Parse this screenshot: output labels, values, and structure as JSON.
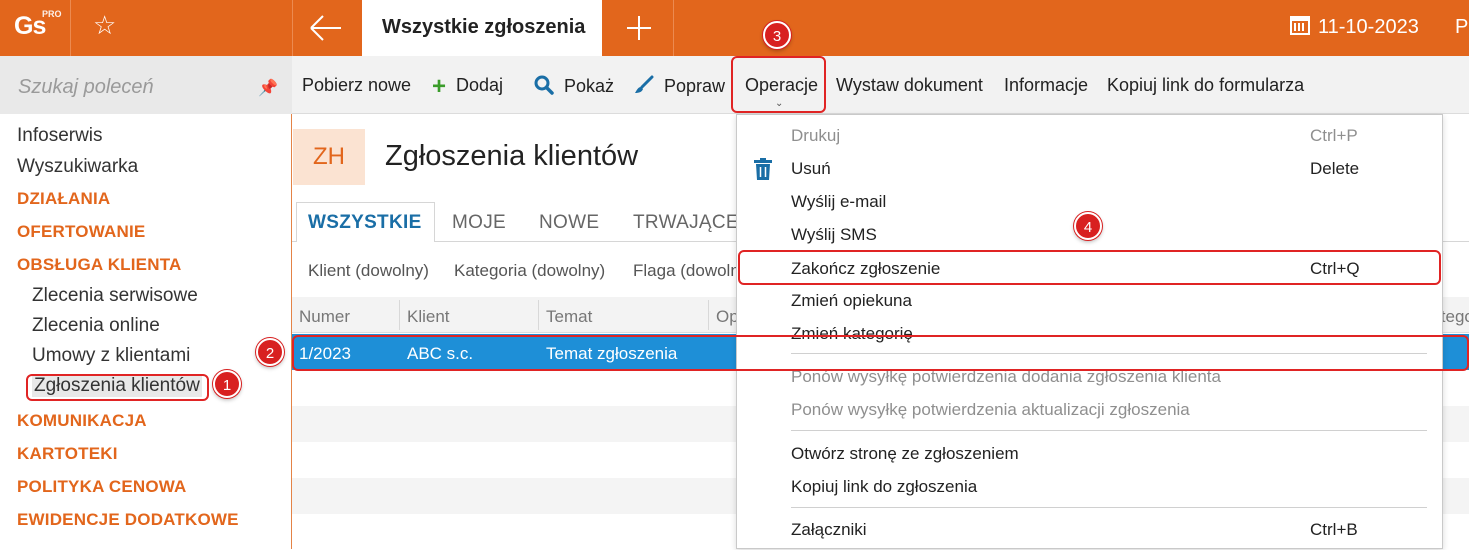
{
  "app": {
    "logo_text": "Gs",
    "logo_badge": "PRO",
    "active_tab": "Wszystkie zgłoszenia",
    "date": "11-10-2023",
    "user_initials_partial": "P("
  },
  "sidebar": {
    "search_placeholder": "Szukaj poleceń",
    "items": [
      {
        "label": "Infoserwis",
        "type": "item"
      },
      {
        "label": "Wyszukiwarka",
        "type": "item"
      },
      {
        "label": "DZIAŁANIA",
        "type": "section"
      },
      {
        "label": "OFERTOWANIE",
        "type": "section"
      },
      {
        "label": "OBSŁUGA KLIENTA",
        "type": "section"
      },
      {
        "label": "Zlecenia serwisowe",
        "type": "sub"
      },
      {
        "label": "Zlecenia online",
        "type": "sub"
      },
      {
        "label": "Umowy z klientami",
        "type": "sub"
      },
      {
        "label": "Zgłoszenia klientów",
        "type": "sub",
        "selected": true
      },
      {
        "label": "KOMUNIKACJA",
        "type": "section"
      },
      {
        "label": "KARTOTEKI",
        "type": "section"
      },
      {
        "label": "POLITYKA CENOWA",
        "type": "section"
      },
      {
        "label": "EWIDENCJE DODATKOWE",
        "type": "section"
      }
    ]
  },
  "toolbar": {
    "fetch_new": "Pobierz nowe",
    "add": "Dodaj",
    "show": "Pokaż",
    "edit": "Popraw",
    "operations": "Operacje",
    "issue_document": "Wystaw dokument",
    "info": "Informacje",
    "copy_form_link": "Kopiuj link do formularza"
  },
  "page": {
    "badge": "ZH",
    "title": "Zgłoszenia klientów",
    "tabs": [
      "WSZYSTKIE",
      "MOJE",
      "NOWE",
      "TRWAJĄCE"
    ],
    "filters": [
      "Klient (dowolny)",
      "Kategoria (dowolny)",
      "Flaga (dowolna)"
    ],
    "columns": [
      "Numer",
      "Klient",
      "Temat",
      "Op",
      "Katego"
    ],
    "rows": [
      {
        "numer": "1/2023",
        "klient": "ABC s.c.",
        "temat": "Temat zgłoszenia"
      }
    ]
  },
  "menu": {
    "items": [
      {
        "label": "Drukuj",
        "shortcut": "Ctrl+P",
        "disabled": true
      },
      {
        "label": "Usuń",
        "shortcut": "Delete",
        "disabled": false
      },
      {
        "label": "Wyślij e-mail",
        "shortcut": "",
        "disabled": false
      },
      {
        "label": "Wyślij SMS",
        "shortcut": "",
        "disabled": false
      },
      {
        "label": "Zakończ zgłoszenie",
        "shortcut": "Ctrl+Q",
        "disabled": false
      },
      {
        "label": "Zmień opiekuna",
        "shortcut": "",
        "disabled": false
      },
      {
        "label": "Zmień kategorię",
        "shortcut": "",
        "disabled": false
      },
      {
        "label": "Ponów wysyłkę potwierdzenia dodania zgłoszenia klienta",
        "shortcut": "",
        "disabled": true
      },
      {
        "label": "Ponów wysyłkę potwierdzenia aktualizacji zgłoszenia",
        "shortcut": "",
        "disabled": true
      },
      {
        "label": "Otwórz stronę ze zgłoszeniem",
        "shortcut": "",
        "disabled": false
      },
      {
        "label": "Kopiuj link do zgłoszenia",
        "shortcut": "",
        "disabled": false
      },
      {
        "label": "Załączniki",
        "shortcut": "Ctrl+B",
        "disabled": false
      }
    ]
  },
  "annotations": [
    "1",
    "2",
    "3",
    "4"
  ],
  "colors": {
    "brand_orange": "#e2661c",
    "selection_blue": "#1e8fd7",
    "tab_active_blue": "#1a6ea6",
    "highlight_red": "#e02424"
  }
}
